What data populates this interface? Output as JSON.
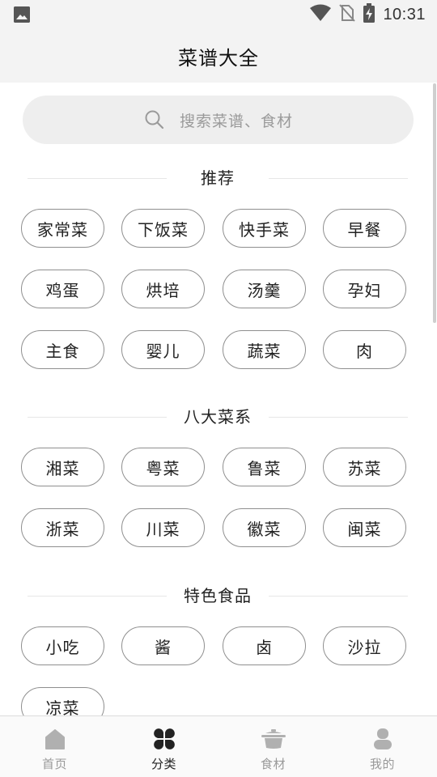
{
  "status_bar": {
    "time": "10:31",
    "icons": [
      "gallery-icon",
      "wifi-icon",
      "no-sim-icon",
      "battery-charging-icon"
    ]
  },
  "header": {
    "title": "菜谱大全"
  },
  "search": {
    "placeholder": "搜索菜谱、食材",
    "icon": "search-icon"
  },
  "sections": [
    {
      "title": "推荐",
      "items": [
        "家常菜",
        "下饭菜",
        "快手菜",
        "早餐",
        "鸡蛋",
        "烘培",
        "汤羹",
        "孕妇",
        "主食",
        "婴儿",
        "蔬菜",
        "肉"
      ]
    },
    {
      "title": "八大菜系",
      "items": [
        "湘菜",
        "粤菜",
        "鲁菜",
        "苏菜",
        "浙菜",
        "川菜",
        "徽菜",
        "闽菜"
      ]
    },
    {
      "title": "特色食品",
      "items": [
        "小吃",
        "酱",
        "卤",
        "沙拉",
        "凉菜"
      ]
    }
  ],
  "bottom_nav": [
    {
      "label": "首页",
      "icon": "home-icon",
      "active": false
    },
    {
      "label": "分类",
      "icon": "category-icon",
      "active": true
    },
    {
      "label": "食材",
      "icon": "pot-icon",
      "active": false
    },
    {
      "label": "我的",
      "icon": "profile-icon",
      "active": false
    }
  ],
  "colors": {
    "accent": "#222222",
    "inactive": "#999999",
    "chip_border": "#8f8f8f",
    "search_bg": "#eeeeee"
  }
}
